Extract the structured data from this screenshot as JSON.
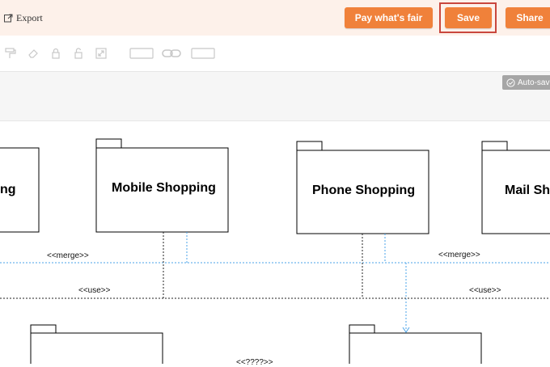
{
  "topbar": {
    "export_label": "Export",
    "pay_label": "Pay what's fair",
    "save_label": "Save",
    "share_label": "Share"
  },
  "status": {
    "autosave_label": "Auto-sav"
  },
  "diagram": {
    "packages": [
      {
        "label": "ng"
      },
      {
        "label": "Mobile Shopping"
      },
      {
        "label": "Phone Shopping"
      },
      {
        "label": "Mail Sh"
      }
    ],
    "relations": [
      {
        "label": "<<merge>>"
      },
      {
        "label": "<<merge>>"
      },
      {
        "label": "<<use>>"
      },
      {
        "label": "<<use>>"
      },
      {
        "label": "<<????>>"
      }
    ]
  },
  "colors": {
    "accent": "#f0813a",
    "highlight": "#c9473d",
    "merge_line": "#4aa3e8"
  }
}
